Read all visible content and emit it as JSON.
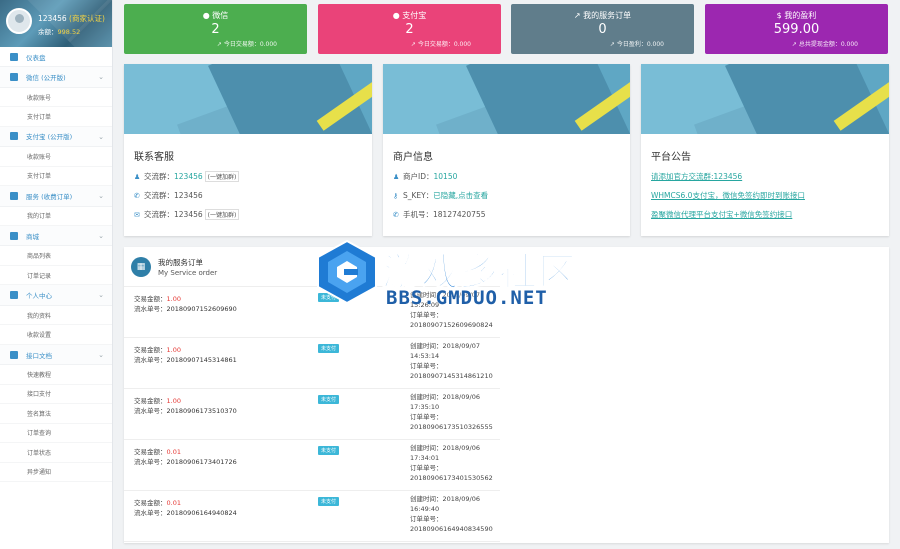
{
  "profile": {
    "name": "123456",
    "tag": "(商家认证)",
    "balance_label": "余额：",
    "balance": "998.52"
  },
  "sidebar": [
    {
      "type": "item",
      "label": "仪表盘"
    },
    {
      "type": "group",
      "label": "微信 (公开版)"
    },
    {
      "type": "sub",
      "label": "收款账号"
    },
    {
      "type": "sub",
      "label": "支付订单"
    },
    {
      "type": "group",
      "label": "支付宝 (公开版)"
    },
    {
      "type": "sub",
      "label": "收款账号"
    },
    {
      "type": "sub",
      "label": "支付订单"
    },
    {
      "type": "group",
      "label": "服务 (收费订单)"
    },
    {
      "type": "sub",
      "label": "我的订单"
    },
    {
      "type": "group",
      "label": "商城"
    },
    {
      "type": "sub",
      "label": "商品列表"
    },
    {
      "type": "sub",
      "label": "订单记录"
    },
    {
      "type": "group",
      "label": "个人中心"
    },
    {
      "type": "sub",
      "label": "我的资料"
    },
    {
      "type": "sub",
      "label": "收款设置"
    },
    {
      "type": "group",
      "label": "接口文档"
    },
    {
      "type": "sub",
      "label": "快速教程"
    },
    {
      "type": "sub",
      "label": "接口支付"
    },
    {
      "type": "sub",
      "label": "签名算法"
    },
    {
      "type": "sub",
      "label": "订单查询"
    },
    {
      "type": "sub",
      "label": "订单状态"
    },
    {
      "type": "sub",
      "label": "异步通知"
    }
  ],
  "stats": [
    {
      "title": "微信",
      "value": "2",
      "sub": "今日交易额：0.000",
      "color": "#4cae4f"
    },
    {
      "title": "支付宝",
      "value": "2",
      "sub": "今日交易额：0.000",
      "color": "#ea4379"
    },
    {
      "title": "我的服务订单",
      "value": "0",
      "sub": "今日盈利：0.000",
      "color": "#607d8b"
    },
    {
      "title": "我的盈利",
      "value": "599.00",
      "sub": "总共提现金额：0.000",
      "color": "#9c27b0"
    }
  ],
  "cards": {
    "service": {
      "title": "联系客服",
      "rows": [
        {
          "label": "交流群：",
          "value": "123456",
          "tag": "(一键加群)"
        },
        {
          "label": "交流群：",
          "value": "123456",
          "tag": ""
        },
        {
          "label": "交流群：",
          "value": "123456",
          "tag": "(一键加群)"
        }
      ]
    },
    "merchant": {
      "title": "商户信息",
      "rows": [
        {
          "label": "商户ID：",
          "value": "10150"
        },
        {
          "label": "S_KEY：",
          "value": "已隐藏,点击查看"
        },
        {
          "label": "手机号：",
          "value": "18127420755"
        }
      ]
    },
    "notice": {
      "title": "平台公告",
      "links": [
        "请添加官方交流群:123456",
        "WHMCS6.0支付宝，微信免签约即时到账接口",
        "盈聚微信代理平台支付宝+微信免签约接口"
      ]
    }
  },
  "orders": {
    "title": "我的服务订单",
    "subtitle": "My Service order",
    "labels": {
      "amount": "交易金额：",
      "serial": "流水单号：",
      "created": "创建时间：",
      "order_no": "订单单号："
    },
    "items": [
      {
        "amount": "1.00",
        "serial": "20180907152609690",
        "status": "未支付",
        "created_date": "2018/09/07",
        "created_time": "15:26:09",
        "order_no": "20180907152609690824"
      },
      {
        "amount": "1.00",
        "serial": "20180907145314861",
        "status": "未支付",
        "created_date": "2018/09/07",
        "created_time": "14:53:14",
        "order_no": "20180907145314861210"
      },
      {
        "amount": "1.00",
        "serial": "20180906173510370",
        "status": "未支付",
        "created_date": "2018/09/06",
        "created_time": "17:35:10",
        "order_no": "20180906173510326555"
      },
      {
        "amount": "0.01",
        "serial": "20180906173401726",
        "status": "未支付",
        "created_date": "2018/09/06",
        "created_time": "17:34:01",
        "order_no": "20180906173401530562"
      },
      {
        "amount": "0.01",
        "serial": "20180906164940824",
        "status": "未支付",
        "created_date": "2018/09/06",
        "created_time": "16:49:40",
        "order_no": "20180906164940834590"
      }
    ]
  },
  "watermark": {
    "text": "游戏多社区",
    "url": "BBS.GMDUO.NET"
  },
  "icons": {
    "wechat": "wechat-icon",
    "alipay": "alipay-icon",
    "trend": "trend-icon",
    "money": "money-icon",
    "user": "user-icon",
    "key": "key-icon",
    "phone": "phone-icon",
    "mail": "mail-icon",
    "grid": "grid-icon",
    "chevron": "chevron-down-icon"
  }
}
